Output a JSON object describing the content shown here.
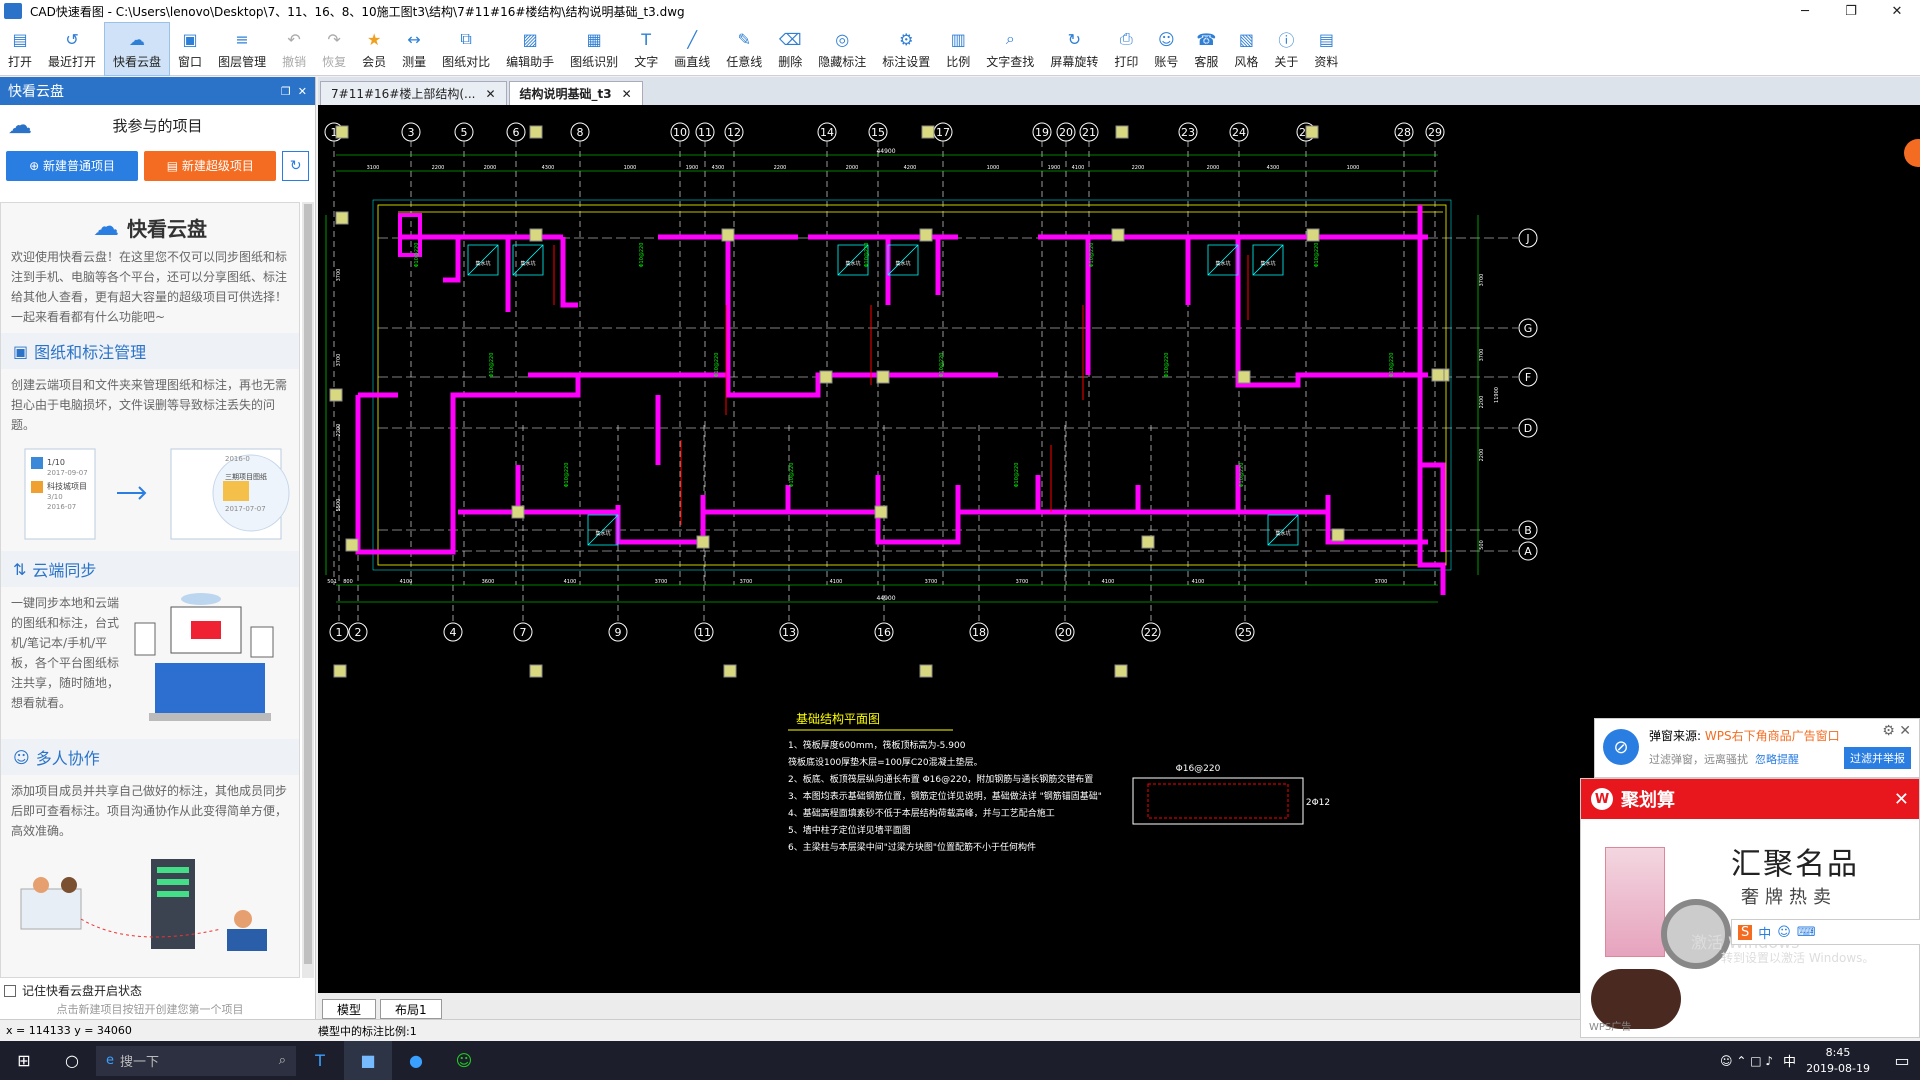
{
  "window": {
    "title": "CAD快速看图 - C:\\Users\\lenovo\\Desktop\\7、11、16、8、10施工图t3\\结构\\7#11#16#楼结构\\结构说明基础_t3.dwg"
  },
  "ribbon": [
    {
      "label": "打开",
      "icon": "folder-icon",
      "active": false,
      "disabled": false
    },
    {
      "label": "最近打开",
      "icon": "recent-icon",
      "active": false,
      "disabled": false
    },
    {
      "label": "快看云盘",
      "icon": "cloud-icon",
      "active": true,
      "disabled": false
    },
    {
      "label": "窗口",
      "icon": "window-icon",
      "active": false,
      "disabled": false
    },
    {
      "label": "图层管理",
      "icon": "layers-icon",
      "active": false,
      "disabled": false
    },
    {
      "label": "撤销",
      "icon": "undo-icon",
      "active": false,
      "disabled": true
    },
    {
      "label": "恢复",
      "icon": "redo-icon",
      "active": false,
      "disabled": true
    },
    {
      "label": "会员",
      "icon": "vip-icon",
      "active": false,
      "disabled": false
    },
    {
      "label": "测量",
      "icon": "measure-icon",
      "active": false,
      "disabled": false
    },
    {
      "label": "图纸对比",
      "icon": "compare-icon",
      "active": false,
      "disabled": false
    },
    {
      "label": "编辑助手",
      "icon": "edit-helper-icon",
      "active": false,
      "disabled": false
    },
    {
      "label": "图纸识别",
      "icon": "recognize-icon",
      "active": false,
      "disabled": false
    },
    {
      "label": "文字",
      "icon": "text-icon",
      "active": false,
      "disabled": false
    },
    {
      "label": "画直线",
      "icon": "line-icon",
      "active": false,
      "disabled": false
    },
    {
      "label": "任意线",
      "icon": "pen-icon",
      "active": false,
      "disabled": false
    },
    {
      "label": "删除",
      "icon": "eraser-icon",
      "active": false,
      "disabled": false
    },
    {
      "label": "隐藏标注",
      "icon": "hide-icon",
      "active": false,
      "disabled": false
    },
    {
      "label": "标注设置",
      "icon": "annot-settings-icon",
      "active": false,
      "disabled": false
    },
    {
      "label": "比例",
      "icon": "scale-icon",
      "active": false,
      "disabled": false
    },
    {
      "label": "文字查找",
      "icon": "find-text-icon",
      "active": false,
      "disabled": false
    },
    {
      "label": "屏幕旋转",
      "icon": "rotate-icon",
      "active": false,
      "disabled": false
    },
    {
      "label": "打印",
      "icon": "print-icon",
      "active": false,
      "disabled": false
    },
    {
      "label": "账号",
      "icon": "account-icon",
      "active": false,
      "disabled": false
    },
    {
      "label": "客服",
      "icon": "headset-icon",
      "active": false,
      "disabled": false
    },
    {
      "label": "风格",
      "icon": "style-icon",
      "active": false,
      "disabled": false
    },
    {
      "label": "关于",
      "icon": "info-icon",
      "active": false,
      "disabled": false
    },
    {
      "label": "资料",
      "icon": "docs-icon",
      "active": false,
      "disabled": false
    }
  ],
  "sidebar": {
    "header": "快看云盘",
    "project_title": "我参与的项目",
    "new_normal": "新建普通项目",
    "new_super": "新建超级项目",
    "panel_title": "快看云盘",
    "intro": "欢迎使用快看云盘！在这里您不仅可以同步图纸和标注到手机、电脑等各个平台，还可以分享图纸、标注给其他人查看，更有超大容量的超级项目可供选择！一起来看看都有什么功能吧~",
    "sections": [
      {
        "title": "图纸和标注管理",
        "icon": "folder-manage-icon",
        "text": "创建云端项目和文件夹来管理图纸和标注，再也无需担心由于电脑损坏，文件误删等导致标注丢失的问题。"
      },
      {
        "title": "云端同步",
        "icon": "cloud-sync-icon",
        "text": "一键同步本地和云端的图纸和标注，台式机/笔记本/手机/平板，各个平台图纸标注共享，随时随地，想看就看。"
      },
      {
        "title": "多人协作",
        "icon": "collab-icon",
        "text": "添加项目成员并共享自己做好的标注，其他成员同步后即可查看标注。项目沟通协作从此变得简单方便，高效准确。"
      }
    ],
    "illus1": {
      "item1": "1/10",
      "date1": "2017-09-07",
      "name2": "科技城项目",
      "frac2": "3/10",
      "date2": "2016-07",
      "name3": "三期项目图纸",
      "date3": "2017-07-07",
      "date4": "2016-0"
    },
    "remember": "记住快看云盘开启状态",
    "hint": "点击新建项目按钮开创建您第一个项目"
  },
  "tabs": [
    {
      "label": "7#11#16#楼上部结构(...",
      "active": false
    },
    {
      "label": "结构说明基础_t3",
      "active": true
    }
  ],
  "drawing": {
    "top_axes": [
      "1",
      "3",
      "5",
      "6",
      "8",
      "10",
      "11",
      "12",
      "14",
      "15",
      "17",
      "19",
      "20",
      "21",
      "23",
      "24",
      "26",
      "28",
      "29"
    ],
    "bottom_axes": [
      "1",
      "2",
      "4",
      "7",
      "9",
      "11",
      "13",
      "16",
      "18",
      "20",
      "22",
      "25"
    ],
    "right_axes": [
      "J",
      "G",
      "F",
      "D",
      "B",
      "A"
    ],
    "total_dim": "44900",
    "top_dims": [
      "3100",
      "2200",
      "2000",
      "4300",
      "1000",
      "1900",
      "4300",
      "2200",
      "2000",
      "4200",
      "1000",
      "1900",
      "4100",
      "2200",
      "2000",
      "4300",
      "1000"
    ],
    "bottom_dims": [
      "501",
      "800",
      "4100",
      "3600",
      "4100",
      "3700",
      "3700",
      "4100",
      "3700",
      "3700",
      "4100",
      "4100",
      "3700"
    ],
    "left_dims": [
      "3700",
      "3700",
      "2200",
      "5500"
    ],
    "right_dims": [
      "3700",
      "3700",
      "2200",
      "2200",
      "500",
      "11900"
    ],
    "notes_title": "基础结构平面图",
    "notes": [
      "1、筏板厚度600mm，筏板顶标高为-5.900",
      "   筏板底设100厚垫木层=100厚C20混凝土垫层。",
      "2、板底、板顶筏层纵向通长布置 Φ16@220，附加钢筋与通长钢筋交错布置",
      "3、本图均表示基础钢筋位置，钢筋定位详见说明，基础做法详 \"钢筋锚固基础\"",
      "4、基础高程面填素砂不低于本层结构荷载高峰，并与工艺配合施工",
      "5、墙中柱子定位详见墙平面图",
      "6、主梁柱与本层梁中间\"过梁方块图\"位置配筋不小于任何构件"
    ],
    "detail_label": "Φ16@220",
    "detail_label2": "2Φ12",
    "annot_labels": [
      "集水坑",
      "集水坑",
      "集水坑",
      "集水坑",
      "集水坑",
      "集水坑",
      "集水坑",
      "集水坑"
    ]
  },
  "model_tabs": [
    "模型",
    "布局1"
  ],
  "status": {
    "coords": "x = 114133  y = 34060",
    "scale": "模型中的标注比例:1"
  },
  "popup": {
    "source_label": "弹窗来源:",
    "source_value": "WPS右下角商品广告窗口",
    "filter_text": "过滤弹窗，远离骚扰",
    "remind": "忽略提醒",
    "action": "过滤并举报",
    "brand": "聚划算",
    "headline": "汇聚名品",
    "subline": "奢牌热卖",
    "activate": "激活 Windows",
    "activate2": "转到设置以激活 Windows。",
    "footer": "WPS广告",
    "ime": "中"
  },
  "taskbar": {
    "search": "搜一下",
    "time": "8:45",
    "date": "2019-08-19",
    "lang": "中"
  },
  "colors": {
    "accent": "#2a7de1",
    "wall": "#ff00ff",
    "bg": "#000000",
    "orange": "#f36c21"
  }
}
